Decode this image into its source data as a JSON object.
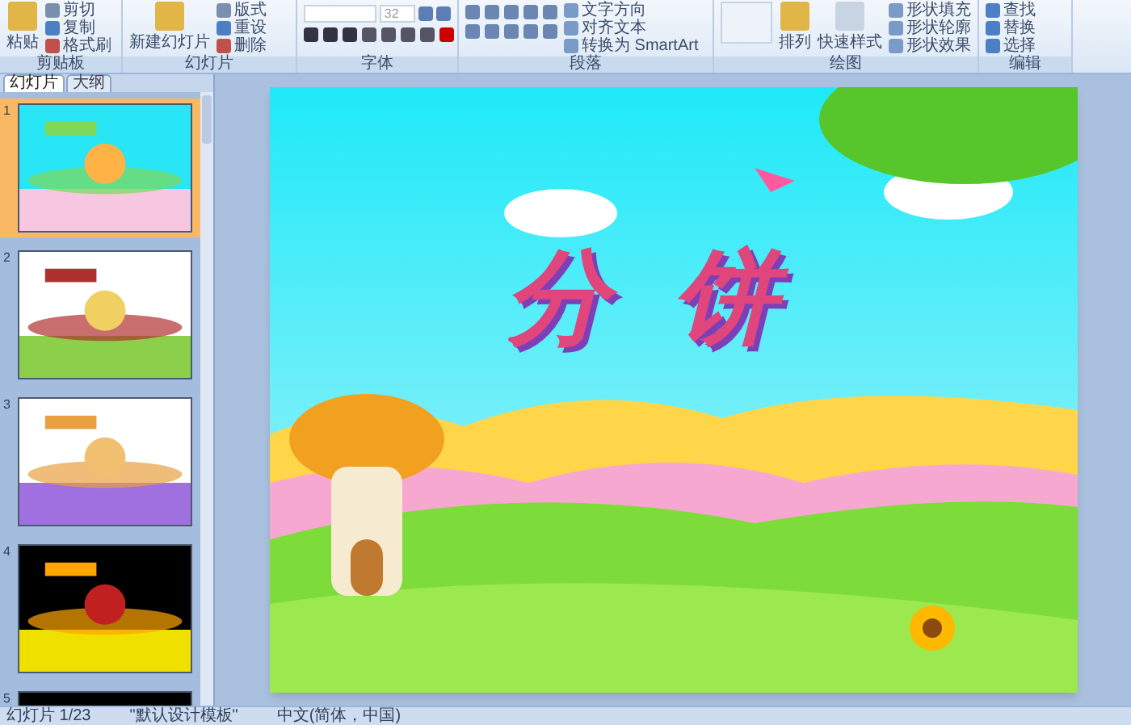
{
  "ribbon": {
    "groups": [
      {
        "label": "剪贴板",
        "kind": "clipboard",
        "large": "粘贴",
        "buttons": [
          "剪切",
          "复制",
          "格式刷"
        ]
      },
      {
        "label": "幻灯片",
        "kind": "clipboard",
        "large": "新建幻灯片",
        "buttons": [
          "版式",
          "重设",
          "删除"
        ]
      },
      {
        "label": "字体",
        "kind": "font",
        "font_size": "32"
      },
      {
        "label": "段落",
        "kind": "paragraph",
        "buttons": [
          "文字方向",
          "对齐文本",
          "转换为 SmartArt"
        ]
      },
      {
        "label": "绘图",
        "kind": "drawing",
        "large": "排列",
        "second": "快速样式",
        "buttons": [
          "形状填充",
          "形状轮廓",
          "形状效果"
        ]
      },
      {
        "label": "编辑",
        "kind": "editing",
        "buttons": [
          "查找",
          "替换",
          "选择"
        ]
      }
    ]
  },
  "panel": {
    "tabs": [
      {
        "label": "幻灯片",
        "selected": true
      },
      {
        "label": "大纲",
        "selected": false
      }
    ],
    "slides": [
      {
        "number": "1",
        "selected": true,
        "kind": "sky"
      },
      {
        "number": "2",
        "selected": false,
        "kind": "warm"
      },
      {
        "number": "3",
        "selected": false,
        "kind": "white"
      },
      {
        "number": "4",
        "selected": false,
        "kind": "dark"
      },
      {
        "number": "5",
        "selected": false,
        "kind": "dark"
      }
    ]
  },
  "slide": {
    "title": "分饼"
  },
  "status_bar": [
    "幻灯片 1/23",
    "\"默认设计模板\"",
    "中文(简体，中国)"
  ]
}
